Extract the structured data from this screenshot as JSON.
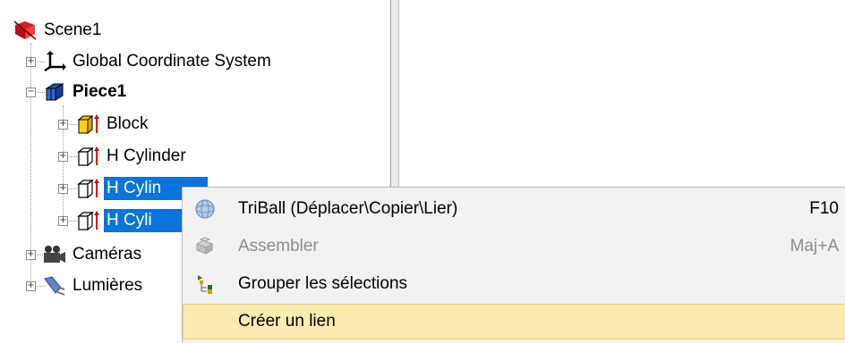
{
  "tree": {
    "root": {
      "label": "Scene1"
    },
    "global": {
      "label": "Global Coordinate System"
    },
    "piece": {
      "label": "Piece1"
    },
    "children": [
      {
        "label": "Block"
      },
      {
        "label": "H Cylinder"
      },
      {
        "label": "H Cylin"
      },
      {
        "label": "H Cyli"
      }
    ],
    "cameras": {
      "label": "Caméras"
    },
    "lights": {
      "label": "Lumières"
    }
  },
  "context_menu": {
    "items": [
      {
        "label": "TriBall (Déplacer\\Copier\\Lier)",
        "shortcut": "F10",
        "enabled": true,
        "icon": "triball-icon"
      },
      {
        "label": "Assembler",
        "shortcut": "Maj+A",
        "enabled": false,
        "icon": "assemble-icon"
      },
      {
        "label": "Grouper les sélections",
        "shortcut": "",
        "enabled": true,
        "icon": "group-icon"
      },
      {
        "label": "Créer un lien",
        "shortcut": "",
        "enabled": true,
        "icon": "",
        "highlighted": true
      }
    ]
  },
  "colors": {
    "selection": "#0a74da",
    "menu_bg": "#f2f2f2",
    "menu_hover": "#fbeab1"
  }
}
